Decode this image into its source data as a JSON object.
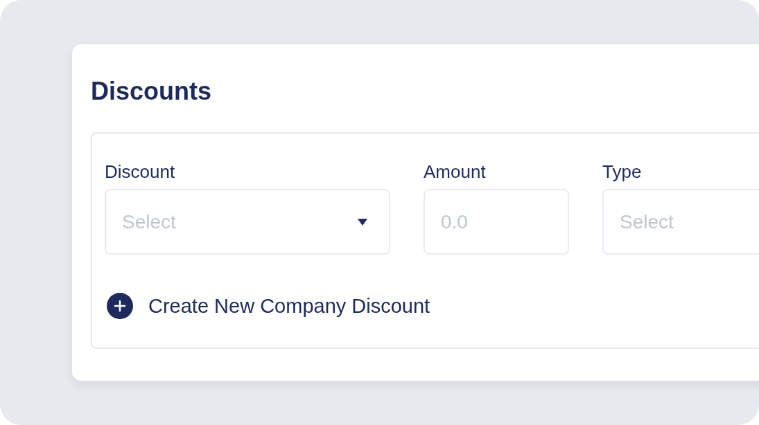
{
  "title": "Discounts",
  "fields": [
    {
      "kind": "dropdown",
      "label": "Discount",
      "placeholder": "Select"
    },
    {
      "kind": "field",
      "label": "Amount",
      "placeholder": "0.0"
    },
    {
      "kind": "field",
      "label": "Type",
      "placeholder": "Select"
    }
  ],
  "create_action": {
    "label": "Create New Company Discount"
  }
}
